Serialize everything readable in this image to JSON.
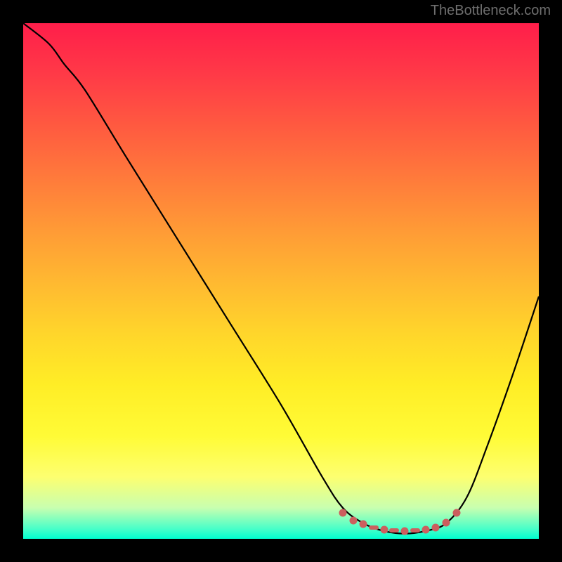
{
  "watermark": "TheBottleneck.com",
  "chart_data": {
    "type": "line",
    "title": "",
    "xlabel": "",
    "ylabel": "",
    "xlim": [
      0,
      100
    ],
    "ylim": [
      0,
      100
    ],
    "series": [
      {
        "name": "curve",
        "x": [
          0,
          5,
          8,
          12,
          20,
          30,
          40,
          50,
          58,
          62,
          66,
          70,
          74,
          78,
          82,
          86,
          90,
          95,
          100
        ],
        "y": [
          100,
          96,
          92,
          87,
          74,
          58,
          42,
          26,
          12,
          6,
          3,
          1.5,
          1,
          1.5,
          3,
          8,
          18,
          32,
          47
        ]
      }
    ],
    "markers": {
      "name": "bottom-cluster",
      "color": "#cc5f5e",
      "points": [
        {
          "x": 62,
          "y": 5
        },
        {
          "x": 64,
          "y": 3.5
        },
        {
          "x": 66,
          "y": 2.8
        },
        {
          "x": 68,
          "y": 2.2
        },
        {
          "x": 70,
          "y": 1.8
        },
        {
          "x": 72,
          "y": 1.6
        },
        {
          "x": 74,
          "y": 1.5
        },
        {
          "x": 76,
          "y": 1.6
        },
        {
          "x": 78,
          "y": 1.8
        },
        {
          "x": 80,
          "y": 2.2
        },
        {
          "x": 82,
          "y": 3.2
        },
        {
          "x": 84,
          "y": 5
        }
      ]
    },
    "background": {
      "type": "vertical-gradient",
      "stops": [
        {
          "pos": 0,
          "color": "#ff1e4a"
        },
        {
          "pos": 50,
          "color": "#ffb831"
        },
        {
          "pos": 80,
          "color": "#fffb36"
        },
        {
          "pos": 100,
          "color": "#00ffd0"
        }
      ]
    }
  }
}
